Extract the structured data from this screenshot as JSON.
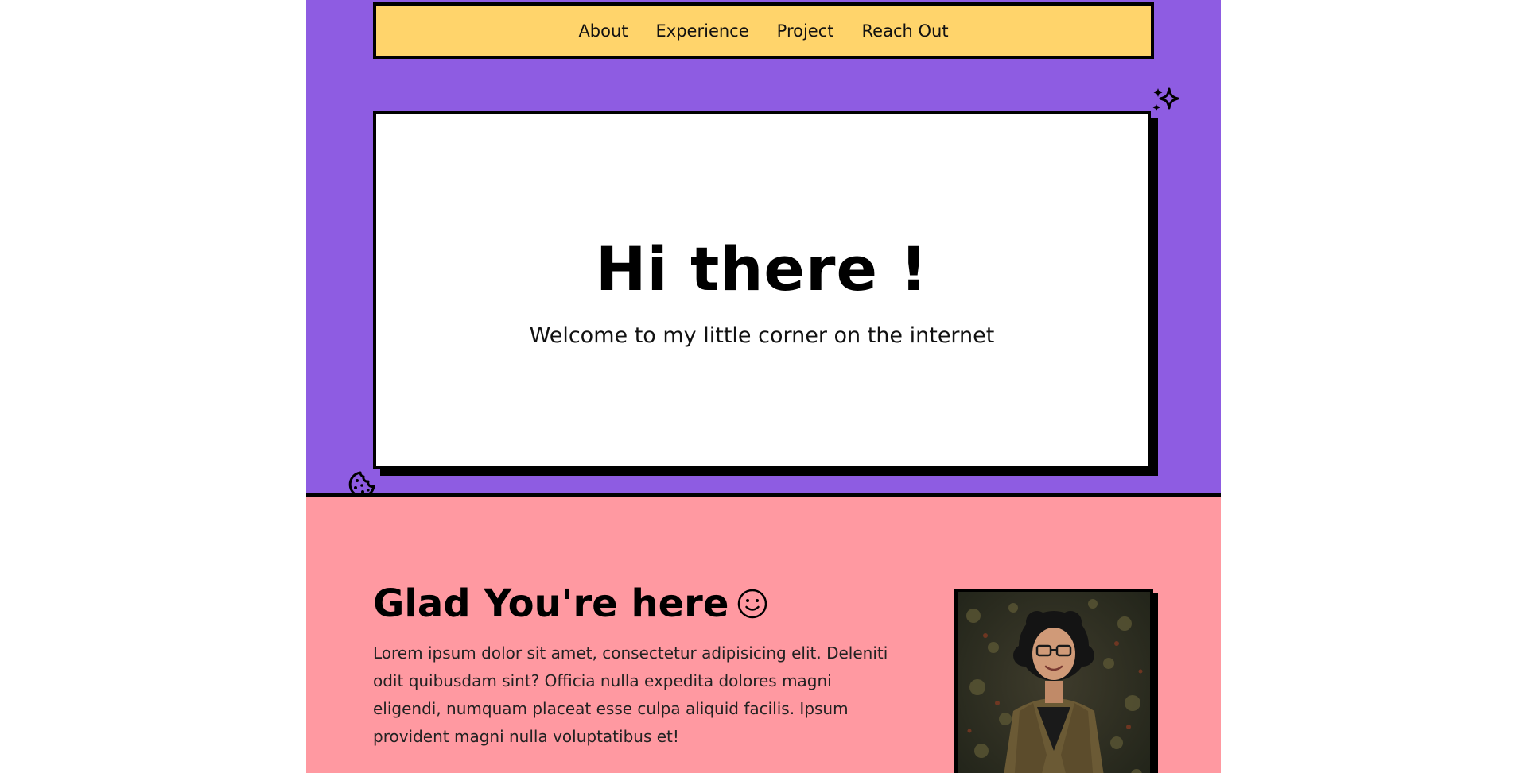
{
  "colors": {
    "hero_background": "#8e5ce2",
    "nav_background": "#ffd46b",
    "about_background": "#ff99a1",
    "card_background": "#ffffff",
    "border": "#000000"
  },
  "nav": {
    "items": [
      {
        "label": "About"
      },
      {
        "label": "Experience"
      },
      {
        "label": "Project"
      },
      {
        "label": "Reach Out"
      }
    ]
  },
  "hero": {
    "title": "Hi there !",
    "subtitle": "Welcome to my little corner on the internet",
    "decorations": [
      "sparkle-icon",
      "cookie-icon"
    ]
  },
  "about": {
    "title": "Glad You're here",
    "title_icon": "smile-icon",
    "text": "Lorem ipsum dolor sit amet, consectetur adipisicing elit. Deleniti odit quibusdam sint? Officia nulla expedita dolores magni eligendi, numquam placeat esse culpa aliquid facilis. Ipsum provident magni nulla voluptatibus et!",
    "photo": "profile-photo"
  }
}
